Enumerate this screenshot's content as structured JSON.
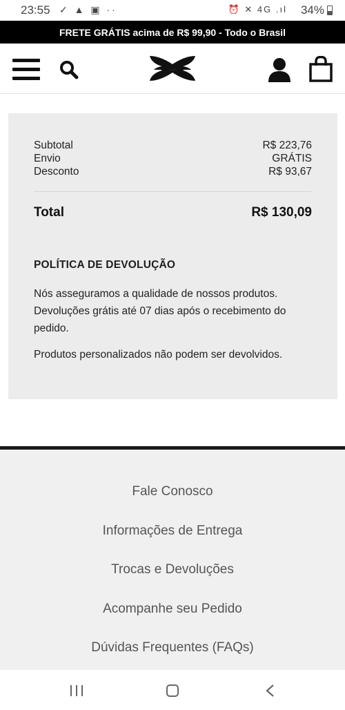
{
  "status_bar": {
    "time": "23:55",
    "notification_icons": "✓ ▲ ▣ ··",
    "network_icons": "⏰ ✕ 4G .ıl",
    "battery": "34%"
  },
  "promo": {
    "text": "FRETE GRÁTIS acima de R$ 99,90 - Todo o Brasil"
  },
  "header": {
    "icons": [
      "menu-icon",
      "search-icon",
      "under-armour-logo",
      "account-icon",
      "bag-icon"
    ]
  },
  "summary": {
    "subtotal_label": "Subtotal",
    "subtotal_value": "R$ 223,76",
    "shipping_label": "Envio",
    "shipping_value": "GRÁTIS",
    "discount_label": "Desconto",
    "discount_value": "R$ 93,67",
    "total_label": "Total",
    "total_value": "R$ 130,09"
  },
  "return_policy": {
    "title": "POLÍTICA DE DEVOLUÇÃO",
    "line1": "Nós asseguramos a qualidade de nossos produtos.",
    "line2": "Devoluções grátis até 07 dias após o recebimento do",
    "line3": "pedido.",
    "note": "Produtos personalizados não podem ser devolvidos."
  },
  "footer": {
    "links": [
      "Fale Conosco",
      "Informações de Entrega",
      "Trocas e Devoluções",
      "Acompanhe seu Pedido",
      "Dúvidas Frequentes (FAQs)"
    ]
  },
  "nav_bar": {
    "icons": [
      "recent-apps-icon",
      "home-icon",
      "back-icon"
    ]
  },
  "colors": {
    "promo_background": "#000000",
    "summary_background": "#ececec",
    "footer_background": "#f0f0f0"
  }
}
